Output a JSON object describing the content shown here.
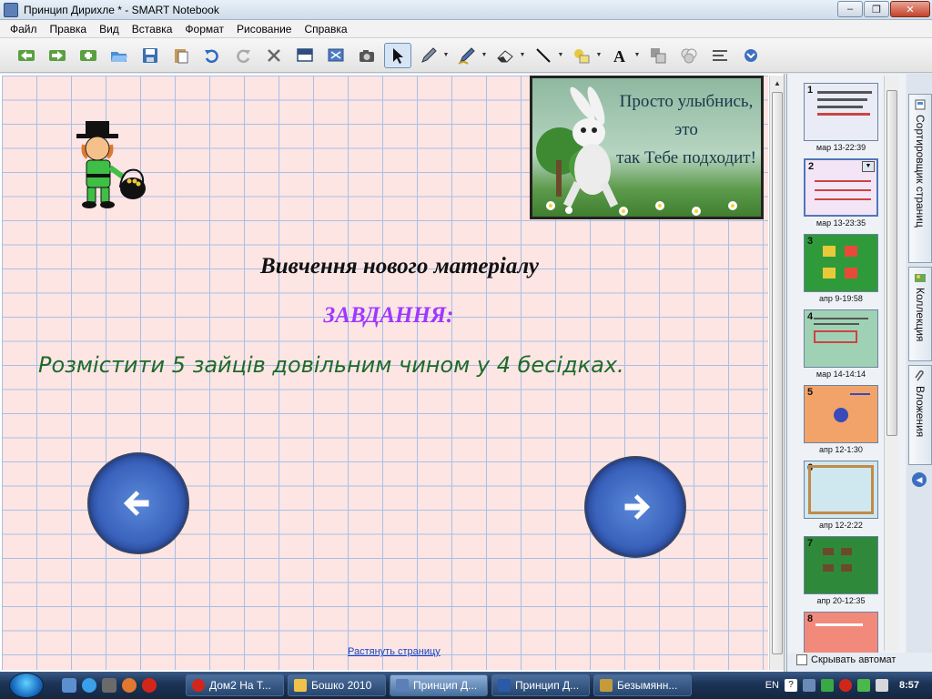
{
  "window": {
    "title": "Принцип Дирихле * - SMART Notebook"
  },
  "menu": [
    "Файл",
    "Правка",
    "Вид",
    "Вставка",
    "Формат",
    "Рисование",
    "Справка"
  ],
  "toolbar": {
    "icons": [
      "back-icon",
      "forward-icon",
      "add-page-icon",
      "open-icon",
      "save-icon",
      "paste-icon",
      "undo-icon",
      "redo-icon",
      "delete-icon",
      "screen-shade-icon",
      "full-screen-icon",
      "capture-icon",
      "select-icon",
      "pen-icon",
      "creative-pen-icon",
      "eraser-icon",
      "line-icon",
      "shape-icon",
      "text-icon",
      "object-icon",
      "fill-icon",
      "properties-icon",
      "more-icon"
    ]
  },
  "slide": {
    "card_text": [
      "Просто улыбнись,",
      "это",
      "так Тебе подходит!"
    ],
    "heading": "Вивчення нового матеріалу",
    "task_label": "ЗАВДАННЯ:",
    "task_text": "Розмістити 5 зайців довільним чином у 4 бесідках.",
    "stretch_link": "Растянуть страницу"
  },
  "sidebar": {
    "thumbnails": [
      {
        "number": "1",
        "caption": "мар 13-22:39",
        "bg": "#e9ecf6"
      },
      {
        "number": "2",
        "caption": "мар 13-23:35",
        "bg": "#f3e5f5"
      },
      {
        "number": "3",
        "caption": "апр 9-19:58",
        "bg": "#2f9a3a"
      },
      {
        "number": "4",
        "caption": "мар 14-14:14",
        "bg": "#9fd2b4"
      },
      {
        "number": "5",
        "caption": "апр 12-1:30",
        "bg": "#f2a36a"
      },
      {
        "number": "6",
        "caption": "апр 12-2:22",
        "bg": "#cfe8ef"
      },
      {
        "number": "7",
        "caption": "апр 20-12:35",
        "bg": "#2e8a3a"
      },
      {
        "number": "8",
        "caption": "",
        "bg": "#f28a7c"
      }
    ],
    "tabs": [
      "Сортировщик страниц",
      "Коллекция",
      "Вложения"
    ],
    "autohide_label": "Скрывать автомат"
  },
  "taskbar": {
    "windows": [
      {
        "label": "Дом2 На Т...",
        "color": "#d3261b"
      },
      {
        "label": "Бошко 2010",
        "color": "#f0c24a"
      },
      {
        "label": "Принцип Д...",
        "color": "#5c7fb8",
        "active": true
      },
      {
        "label": "Принцип Д...",
        "color": "#2a5aa8"
      },
      {
        "label": "Безымянн...",
        "color": "#c49a3a"
      }
    ],
    "lang": "EN",
    "clock": "8:57"
  }
}
